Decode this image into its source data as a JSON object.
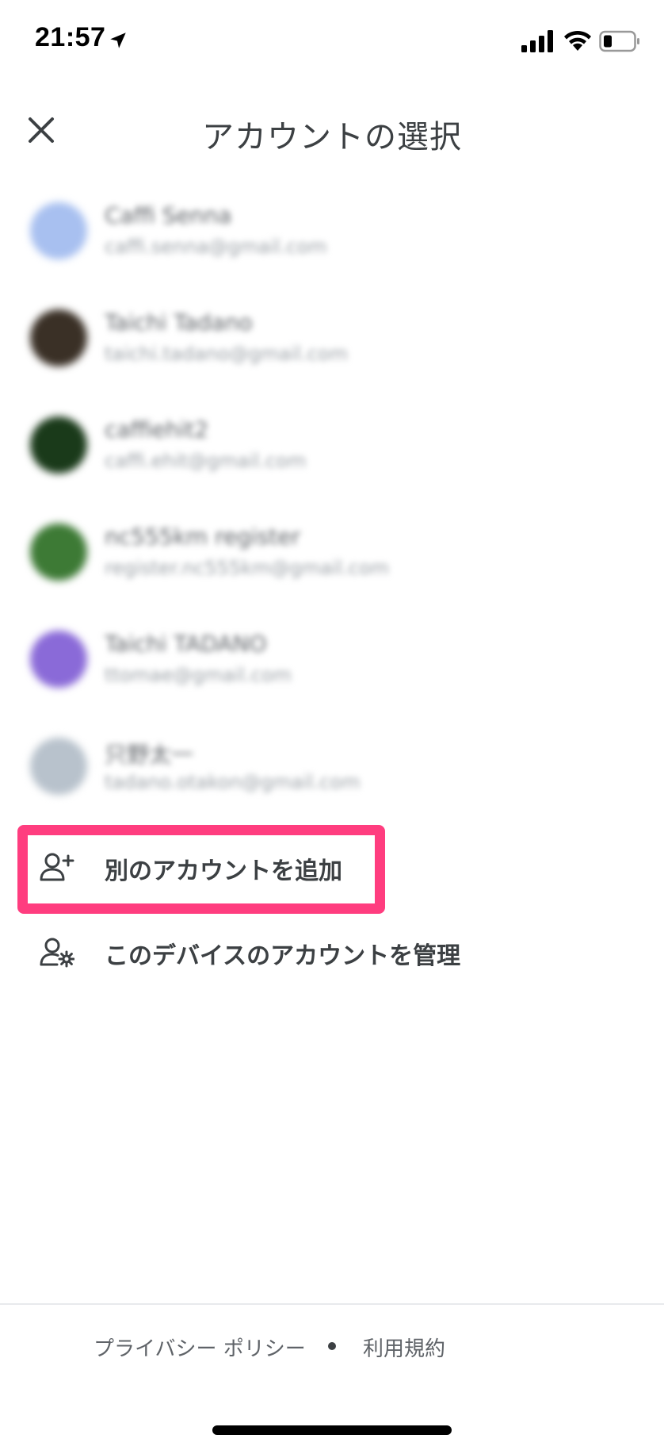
{
  "status_bar": {
    "time": "21:57"
  },
  "header": {
    "title": "アカウントの選択"
  },
  "accounts": [
    {
      "name": "Caffi Senna",
      "email": "caffi.senna@gmail.com",
      "avatar_color": "#a8c0f0"
    },
    {
      "name": "Taichi Tadano",
      "email": "taichi.tadano@gmail.com",
      "avatar_color": "#3a3026"
    },
    {
      "name": "caffiehit2",
      "email": "caffi.ehit@gmail.com",
      "avatar_color": "#1a3a1a"
    },
    {
      "name": "nc555km register",
      "email": "register.nc555km@gmail.com",
      "avatar_color": "#3d7a35"
    },
    {
      "name": "Taichi TADANO",
      "email": "ttomae@gmail.com",
      "avatar_color": "#8a6ad8"
    },
    {
      "name": "只野太一",
      "email": "tadano.otakon@gmail.com",
      "avatar_color": "#b8c2cc"
    }
  ],
  "actions": {
    "add_account": "別のアカウントを追加",
    "manage_accounts": "このデバイスのアカウントを管理"
  },
  "footer": {
    "privacy": "プライバシー ポリシー",
    "terms": "利用規約"
  },
  "colors": {
    "highlight": "#ff3d7f",
    "text_primary": "#3c4043"
  }
}
